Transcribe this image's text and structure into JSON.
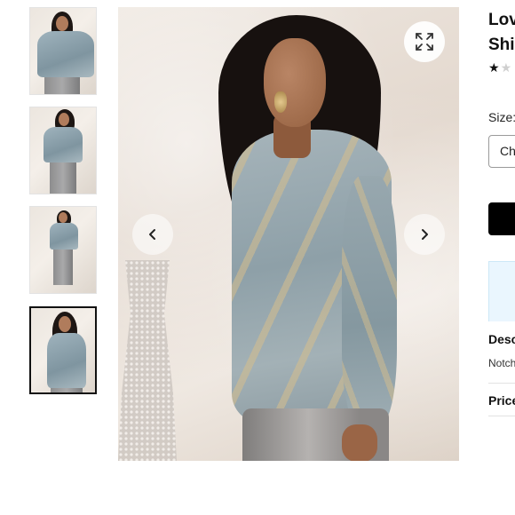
{
  "thumbnails": [
    {
      "alt": "Look 1",
      "active": false
    },
    {
      "alt": "Look 2",
      "active": false
    },
    {
      "alt": "Look 3",
      "active": false
    },
    {
      "alt": "Look 4",
      "active": true
    }
  ],
  "gallery": {
    "expand_icon": "expand-arrows-icon",
    "prev_icon": "chevron-left-icon",
    "next_icon": "chevron-right-icon",
    "prev_glyph": "‹",
    "next_glyph": "›"
  },
  "product": {
    "title_line1": "Lov",
    "title_line2": "Shi",
    "rating": {
      "filled": "★",
      "empty": "★"
    },
    "size_label": "Size:",
    "size_value": "Ch",
    "description_heading": "Desc",
    "description_text": "Notch",
    "price_heading": "Price"
  },
  "colors": {
    "accent": "#000000",
    "promo_bg": "#eaf6fe",
    "divider": "#e2e2e2"
  }
}
